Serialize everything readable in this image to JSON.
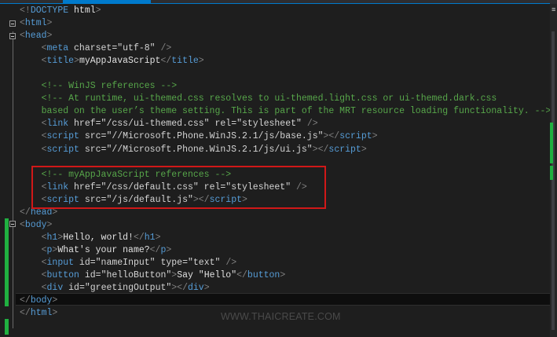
{
  "editor": {
    "lines": [
      [
        [
          "b",
          "<!"
        ],
        [
          "t",
          "DOCTYPE"
        ],
        [
          "x",
          " html"
        ],
        [
          "b",
          ">"
        ]
      ],
      [
        [
          "b",
          "<"
        ],
        [
          "t",
          "html"
        ],
        [
          "b",
          ">"
        ]
      ],
      [
        [
          "b",
          "<"
        ],
        [
          "t",
          "head"
        ],
        [
          "b",
          ">"
        ]
      ],
      [
        [
          "x",
          "    "
        ],
        [
          "b",
          "<"
        ],
        [
          "t",
          "meta"
        ],
        [
          "a",
          " charset"
        ],
        [
          "x",
          "="
        ],
        [
          "s",
          "\"utf-8\""
        ],
        [
          "b",
          " />"
        ]
      ],
      [
        [
          "x",
          "    "
        ],
        [
          "b",
          "<"
        ],
        [
          "t",
          "title"
        ],
        [
          "b",
          ">"
        ],
        [
          "x",
          "myAppJavaScript"
        ],
        [
          "b",
          "</"
        ],
        [
          "t",
          "title"
        ],
        [
          "b",
          ">"
        ]
      ],
      [],
      [
        [
          "x",
          "    "
        ],
        [
          "c",
          "<!-- WinJS references -->"
        ]
      ],
      [
        [
          "x",
          "    "
        ],
        [
          "c",
          "<!-- At runtime, ui-themed.css resolves to ui-themed.light.css or ui-themed.dark.css"
        ]
      ],
      [
        [
          "x",
          "    "
        ],
        [
          "c",
          "based on the user’s theme setting. This is part of the MRT resource loading functionality. -->"
        ]
      ],
      [
        [
          "x",
          "    "
        ],
        [
          "b",
          "<"
        ],
        [
          "t",
          "link"
        ],
        [
          "a",
          " href"
        ],
        [
          "x",
          "="
        ],
        [
          "s",
          "\"/css/ui-themed.css\""
        ],
        [
          "a",
          " rel"
        ],
        [
          "x",
          "="
        ],
        [
          "s",
          "\"stylesheet\""
        ],
        [
          "b",
          " />"
        ]
      ],
      [
        [
          "x",
          "    "
        ],
        [
          "b",
          "<"
        ],
        [
          "t",
          "script"
        ],
        [
          "a",
          " src"
        ],
        [
          "x",
          "="
        ],
        [
          "s",
          "\"//Microsoft.Phone.WinJS.2.1/js/base.js\""
        ],
        [
          "b",
          "></"
        ],
        [
          "t",
          "script"
        ],
        [
          "b",
          ">"
        ]
      ],
      [
        [
          "x",
          "    "
        ],
        [
          "b",
          "<"
        ],
        [
          "t",
          "script"
        ],
        [
          "a",
          " src"
        ],
        [
          "x",
          "="
        ],
        [
          "s",
          "\"//Microsoft.Phone.WinJS.2.1/js/ui.js\""
        ],
        [
          "b",
          "></"
        ],
        [
          "t",
          "script"
        ],
        [
          "b",
          ">"
        ]
      ],
      [],
      [
        [
          "x",
          "    "
        ],
        [
          "c",
          "<!-- myAppJavaScript references -->"
        ]
      ],
      [
        [
          "x",
          "    "
        ],
        [
          "b",
          "<"
        ],
        [
          "t",
          "link"
        ],
        [
          "a",
          " href"
        ],
        [
          "x",
          "="
        ],
        [
          "s",
          "\"/css/default.css\""
        ],
        [
          "a",
          " rel"
        ],
        [
          "x",
          "="
        ],
        [
          "s",
          "\"stylesheet\""
        ],
        [
          "b",
          " />"
        ]
      ],
      [
        [
          "x",
          "    "
        ],
        [
          "b",
          "<"
        ],
        [
          "t",
          "script"
        ],
        [
          "a",
          " src"
        ],
        [
          "x",
          "="
        ],
        [
          "s",
          "\"/js/default.js\""
        ],
        [
          "b",
          "></"
        ],
        [
          "t",
          "script"
        ],
        [
          "b",
          ">"
        ]
      ],
      [
        [
          "b",
          "</"
        ],
        [
          "t",
          "head"
        ],
        [
          "b",
          ">"
        ]
      ],
      [
        [
          "b",
          "<"
        ],
        [
          "t",
          "body"
        ],
        [
          "b",
          ">"
        ]
      ],
      [
        [
          "x",
          "    "
        ],
        [
          "b",
          "<"
        ],
        [
          "t",
          "h1"
        ],
        [
          "b",
          ">"
        ],
        [
          "x",
          "Hello, world!"
        ],
        [
          "b",
          "</"
        ],
        [
          "t",
          "h1"
        ],
        [
          "b",
          ">"
        ]
      ],
      [
        [
          "x",
          "    "
        ],
        [
          "b",
          "<"
        ],
        [
          "t",
          "p"
        ],
        [
          "b",
          ">"
        ],
        [
          "x",
          "What's your name?"
        ],
        [
          "b",
          "</"
        ],
        [
          "t",
          "p"
        ],
        [
          "b",
          ">"
        ]
      ],
      [
        [
          "x",
          "    "
        ],
        [
          "b",
          "<"
        ],
        [
          "t",
          "input"
        ],
        [
          "a",
          " id"
        ],
        [
          "x",
          "="
        ],
        [
          "s",
          "\"nameInput\""
        ],
        [
          "a",
          " type"
        ],
        [
          "x",
          "="
        ],
        [
          "s",
          "\"text\""
        ],
        [
          "b",
          " />"
        ]
      ],
      [
        [
          "x",
          "    "
        ],
        [
          "b",
          "<"
        ],
        [
          "t",
          "button"
        ],
        [
          "a",
          " id"
        ],
        [
          "x",
          "="
        ],
        [
          "s",
          "\"helloButton\""
        ],
        [
          "b",
          ">"
        ],
        [
          "x",
          "Say \"Hello\""
        ],
        [
          "b",
          "</"
        ],
        [
          "t",
          "button"
        ],
        [
          "b",
          ">"
        ]
      ],
      [
        [
          "x",
          "    "
        ],
        [
          "b",
          "<"
        ],
        [
          "t",
          "div"
        ],
        [
          "a",
          " id"
        ],
        [
          "x",
          "="
        ],
        [
          "s",
          "\"greetingOutput\""
        ],
        [
          "b",
          "></"
        ],
        [
          "t",
          "div"
        ],
        [
          "b",
          ">"
        ]
      ],
      [
        [
          "b",
          "</"
        ],
        [
          "t",
          "body"
        ],
        [
          "b",
          ">"
        ]
      ],
      [
        [
          "b",
          "</"
        ],
        [
          "t",
          "html"
        ],
        [
          "b",
          ">"
        ]
      ]
    ]
  },
  "watermark": "WWW.THAICREATE.COM",
  "colors": {
    "accent": "#007acc",
    "highlight_box": "#d01818",
    "change_bar": "#20b040",
    "comment": "#57a64a",
    "tag": "#569cd6"
  }
}
